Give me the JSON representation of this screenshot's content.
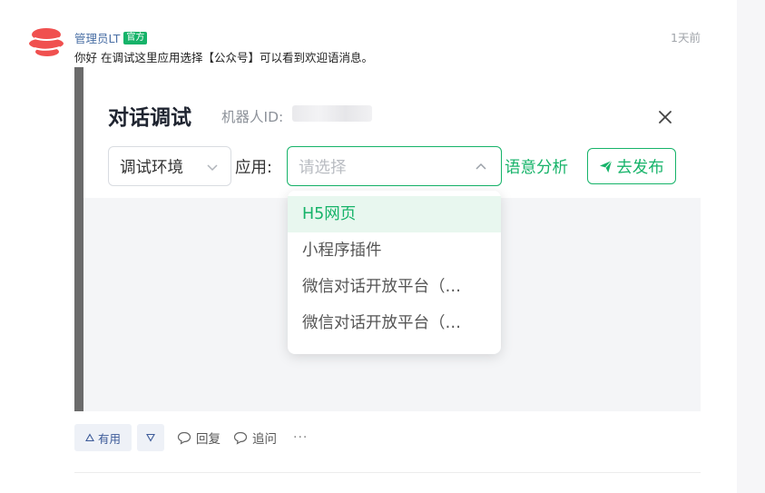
{
  "post": {
    "author": "管理员LT",
    "badge": "官方",
    "time": "1天前",
    "message": "你好 在调试这里应用选择【公众号】可以看到欢迎语消息。"
  },
  "dialog": {
    "title": "对话调试",
    "robot_id_label": "机器人ID:",
    "env_select_value": "调试环境",
    "app_label": "应用:",
    "app_placeholder": "请选择",
    "intent_link": "语意分析",
    "publish_label": "去发布",
    "dropdown_options": [
      "H5网页",
      "小程序插件",
      "微信对话开放平台（…",
      "微信对话开放平台（…"
    ]
  },
  "actions": {
    "useful_label": "有用",
    "reply_label": "回复",
    "followup_label": "追问",
    "more_label": "···"
  },
  "colors": {
    "accent": "#16b369",
    "author": "#4a6fa5",
    "logo": "#f0504f"
  },
  "icons": [
    "logo-icon",
    "close-icon",
    "chevron-down-icon",
    "chevron-up-icon",
    "send-icon",
    "thumb-up-icon",
    "thumb-down-icon",
    "reply-icon",
    "followup-icon"
  ]
}
